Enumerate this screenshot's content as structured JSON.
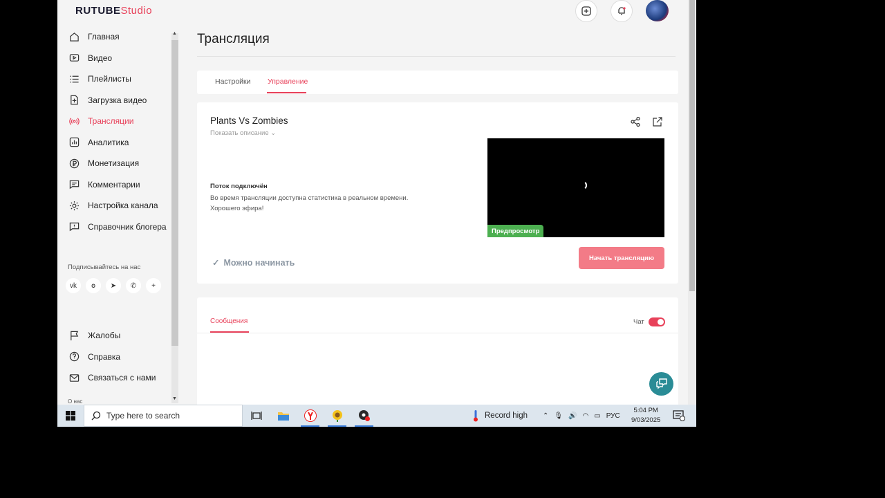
{
  "app": {
    "logo_main": "RUTUBE",
    "logo_sub": "Studio"
  },
  "sidebar": {
    "items": [
      {
        "label": "Главная",
        "icon": "home-icon"
      },
      {
        "label": "Видео",
        "icon": "video-icon"
      },
      {
        "label": "Плейлисты",
        "icon": "playlist-icon"
      },
      {
        "label": "Загрузка видео",
        "icon": "upload-icon"
      },
      {
        "label": "Трансляции",
        "icon": "broadcast-icon",
        "active": true
      },
      {
        "label": "Аналитика",
        "icon": "analytics-icon"
      },
      {
        "label": "Монетизация",
        "icon": "ruble-icon"
      },
      {
        "label": "Комментарии",
        "icon": "comment-icon"
      },
      {
        "label": "Настройка канала",
        "icon": "gear-icon"
      },
      {
        "label": "Справочник блогера",
        "icon": "info-icon"
      }
    ],
    "subscribe_label": "Подписывайтесь на нас",
    "socials": [
      "vk",
      "ok",
      "telegram",
      "viber",
      "+"
    ],
    "bottom_items": [
      {
        "label": "Жалобы",
        "icon": "flag-icon"
      },
      {
        "label": "Справка",
        "icon": "help-icon"
      },
      {
        "label": "Связаться с нами",
        "icon": "mail-icon"
      }
    ],
    "about_label": "О нас"
  },
  "main": {
    "title": "Трансляция",
    "tabs": [
      {
        "label": "Настройки"
      },
      {
        "label": "Управление",
        "active": true
      }
    ],
    "stream": {
      "name": "Plants Vs Zombies",
      "show_description": "Показать описание",
      "status_title": "Поток подключён",
      "status_text": "Во время трансляции доступна статистика в реальном времени. Хорошего эфира!",
      "preview_badge": "Предпросмотр",
      "ready_label": "Можно начинать",
      "start_button": "Начать трансляцию"
    },
    "messages": {
      "tab_label": "Сообщения",
      "chat_label": "Чат",
      "chat_enabled": true
    }
  },
  "taskbar": {
    "search_placeholder": "Type here to search",
    "weather_text": "Record high",
    "language": "РУС",
    "time": "5:04 PM",
    "date": "9/03/2025",
    "notifications": "5"
  },
  "colors": {
    "accent": "#e8415a",
    "start_button": "#f37b87",
    "preview_badge": "#4caf50",
    "help_fab": "#2a8c96"
  }
}
